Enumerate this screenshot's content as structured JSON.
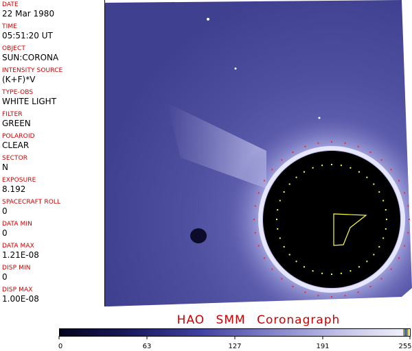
{
  "metadata": [
    {
      "label": "DATE",
      "value": "22 Mar 1980"
    },
    {
      "label": "TIME",
      "value": "05:51:20 UT"
    },
    {
      "label": "OBJECT",
      "value": "SUN:CORONA"
    },
    {
      "label": "INTENSITY SOURCE",
      "value": "(K+F)*V"
    },
    {
      "label": "TYPE-OBS",
      "value": "WHITE LIGHT"
    },
    {
      "label": "FILTER",
      "value": "GREEN"
    },
    {
      "label": "POLAROID",
      "value": "CLEAR"
    },
    {
      "label": "SECTOR",
      "value": "N"
    },
    {
      "label": "EXPOSURE",
      "value": "8.192"
    },
    {
      "label": "SPACECRAFT ROLL",
      "value": "0"
    },
    {
      "label": "DATA MIN",
      "value": "0"
    },
    {
      "label": "DATA MAX",
      "value": "1.21E-08"
    },
    {
      "label": "DISP MIN",
      "value": "0"
    },
    {
      "label": "DISP MAX",
      "value": "1.00E-08"
    }
  ],
  "instrument_title": "HAO   SMM Coronagraph",
  "colorbar": {
    "labels": [
      "0",
      "63",
      "127",
      "191",
      "255"
    ],
    "colors": [
      "#050520",
      "#1a1a5e",
      "#4040a0",
      "#8080c8",
      "#c0c0e8",
      "#f4f4fc"
    ]
  },
  "colors": {
    "label_red": "#cc0000",
    "corona_blue": "#5a5aaa",
    "occulter": "#000000",
    "marker_red": "#ff2020",
    "marker_yellow": "#ffff40"
  }
}
